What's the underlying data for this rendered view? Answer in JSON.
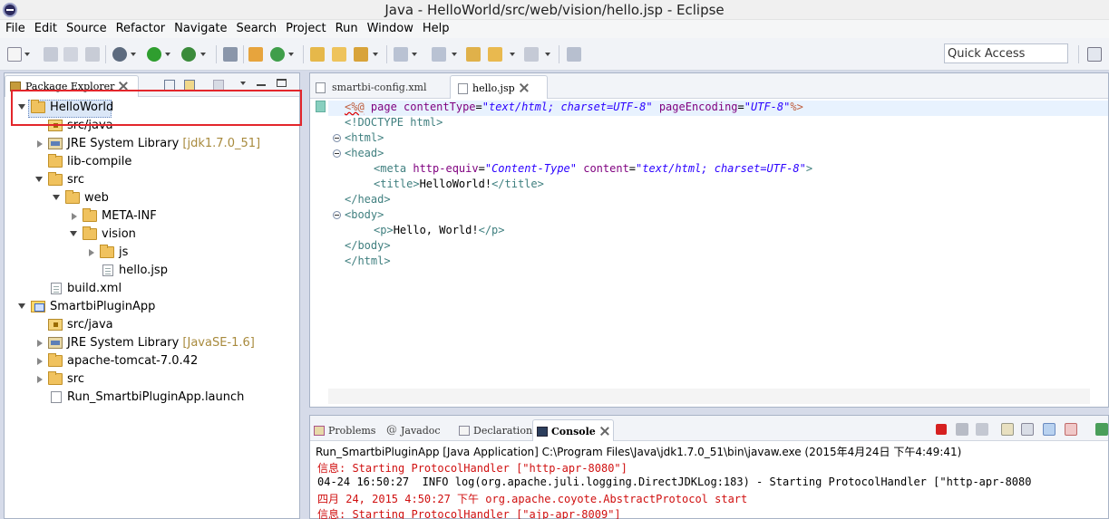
{
  "window": {
    "title": "Java - HelloWorld/src/web/vision/hello.jsp - Eclipse"
  },
  "menu": [
    "File",
    "Edit",
    "Source",
    "Refactor",
    "Navigate",
    "Search",
    "Project",
    "Run",
    "Window",
    "Help"
  ],
  "quick_access": {
    "value": "Quick Access"
  },
  "package_explorer": {
    "tab_label": "Package Explorer",
    "tree": [
      {
        "label": "HelloWorld",
        "decor": ""
      },
      {
        "label": "src/java",
        "decor": ""
      },
      {
        "label": "JRE System Library",
        "decor": "[jdk1.7.0_51]"
      },
      {
        "label": "lib-compile",
        "decor": ""
      },
      {
        "label": "src",
        "decor": ""
      },
      {
        "label": "web",
        "decor": ""
      },
      {
        "label": "META-INF",
        "decor": ""
      },
      {
        "label": "vision",
        "decor": ""
      },
      {
        "label": "js",
        "decor": ""
      },
      {
        "label": "hello.jsp",
        "decor": ""
      },
      {
        "label": "build.xml",
        "decor": ""
      },
      {
        "label": "SmartbiPluginApp",
        "decor": ""
      },
      {
        "label": "src/java",
        "decor": ""
      },
      {
        "label": "JRE System Library",
        "decor": "[JavaSE-1.6]"
      },
      {
        "label": "apache-tomcat-7.0.42",
        "decor": ""
      },
      {
        "label": "src",
        "decor": ""
      },
      {
        "label": "Run_SmartbiPluginApp.launch",
        "decor": ""
      }
    ]
  },
  "editor": {
    "tabs": [
      "smartbi-config.xml",
      "hello.jsp"
    ],
    "code": {
      "l1": {
        "a": "<%@",
        "b": " page ",
        "c": "contentType",
        "d": "=",
        "e": "\"text/html; charset=UTF-8\"",
        "f": " pageEncoding",
        "g": "=",
        "h": "\"UTF-8\"",
        "i": "%>"
      },
      "l2": "<!DOCTYPE html>",
      "l3": "<html>",
      "l4": "<head>",
      "l5": {
        "a": "<meta ",
        "b": "http-equiv",
        "c": "=",
        "d": "\"Content-Type\"",
        "e": " content",
        "f": "=",
        "g": "\"text/html; charset=UTF-8\"",
        "h": ">"
      },
      "l6": {
        "a": "<title>",
        "b": "HelloWorld!",
        "c": "</title>"
      },
      "l7": "</head>",
      "l8": "<body>",
      "l9": {
        "a": "<p>",
        "b": "Hello, World!",
        "c": "</p>"
      },
      "l10": "</body>",
      "l11": "</html>"
    }
  },
  "console": {
    "tabs": [
      "Problems",
      "Javadoc",
      "Declaration",
      "Console"
    ],
    "description": "Run_SmartbiPluginApp [Java Application] C:\\Program Files\\Java\\jdk1.7.0_51\\bin\\javaw.exe (2015年4月24日 下午4:49:41)",
    "lines": [
      "信息: Starting ProtocolHandler [\"http-apr-8080\"]",
      "04-24 16:50:27  INFO log(org.apache.juli.logging.DirectJDKLog:183) - Starting ProtocolHandler [\"http-apr-8080",
      "四月 24, 2015 4:50:27 下午 org.apache.coyote.AbstractProtocol start",
      "信息: Starting ProtocolHandler [\"ajp-apr-8009\"]"
    ]
  }
}
